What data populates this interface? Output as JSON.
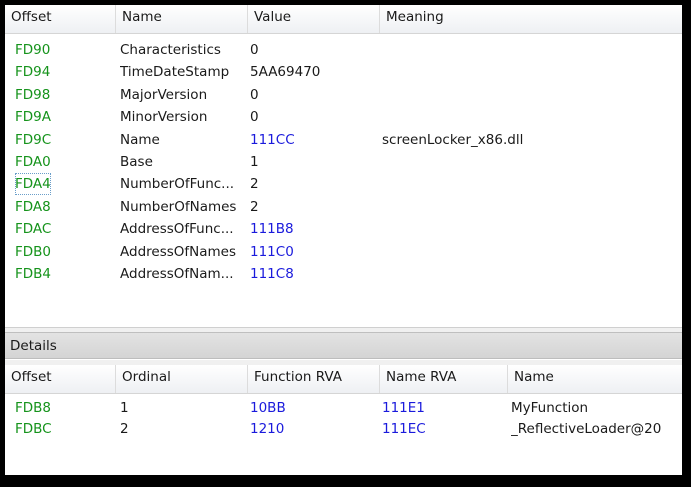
{
  "top_table": {
    "columns": [
      "Offset",
      "Name",
      "Value",
      "Meaning"
    ],
    "rows": [
      {
        "offset": "FD90",
        "name": "Characteristics",
        "value": "0",
        "meaning": "",
        "value_link": false
      },
      {
        "offset": "FD94",
        "name": "TimeDateStamp",
        "value": "5AA69470",
        "meaning": "",
        "value_link": false
      },
      {
        "offset": "FD98",
        "name": "MajorVersion",
        "value": "0",
        "meaning": "",
        "value_link": false
      },
      {
        "offset": "FD9A",
        "name": "MinorVersion",
        "value": "0",
        "meaning": "",
        "value_link": false
      },
      {
        "offset": "FD9C",
        "name": "Name",
        "value": "111CC",
        "meaning": "screenLocker_x86.dll",
        "value_link": true
      },
      {
        "offset": "FDA0",
        "name": "Base",
        "value": "1",
        "meaning": "",
        "value_link": false
      },
      {
        "offset": "FDA4",
        "name": "NumberOfFunc...",
        "value": "2",
        "meaning": "",
        "value_link": false
      },
      {
        "offset": "FDA8",
        "name": "NumberOfNames",
        "value": "2",
        "meaning": "",
        "value_link": false
      },
      {
        "offset": "FDAC",
        "name": "AddressOfFunc...",
        "value": "111B8",
        "meaning": "",
        "value_link": true
      },
      {
        "offset": "FDB0",
        "name": "AddressOfNames",
        "value": "111C0",
        "meaning": "",
        "value_link": true
      },
      {
        "offset": "FDB4",
        "name": "AddressOfNam...",
        "value": "111C8",
        "meaning": "",
        "value_link": true
      }
    ]
  },
  "details": {
    "title": "Details",
    "columns": [
      "Offset",
      "Ordinal",
      "Function RVA",
      "Name RVA",
      "Name"
    ],
    "rows": [
      {
        "offset": "FDB8",
        "ordinal": "1",
        "function_rva": "10BB",
        "name_rva": "111E1",
        "name": "MyFunction"
      },
      {
        "offset": "FDBC",
        "ordinal": "2",
        "function_rva": "1210",
        "name_rva": "111EC",
        "name": "_ReflectiveLoader@20"
      }
    ]
  },
  "colors": {
    "offset_text": "#15931b",
    "link_value": "#1a1adc"
  }
}
